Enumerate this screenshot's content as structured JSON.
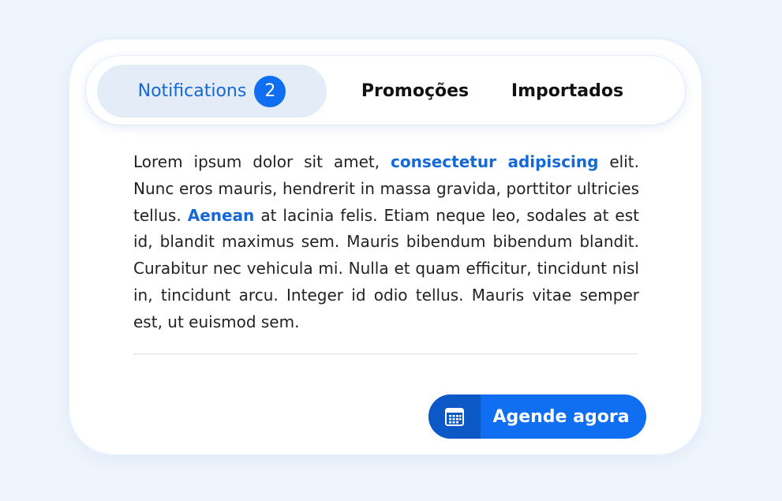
{
  "tabs": {
    "notifications": {
      "label": "Notifications",
      "badge": "2"
    },
    "promocoes": {
      "label": "Promoções"
    },
    "importados": {
      "label": "Importados"
    }
  },
  "content": {
    "p1": "Lorem ipsum dolor sit amet, ",
    "link1": "consectetur adipiscing",
    "p2": " elit. Nunc eros mauris, hendrerit in massa gravida, porttitor ultricies tellus. ",
    "link2": "Aenean",
    "p3": " at lacinia felis. Etiam neque leo, sodales at est id, blandit maximus sem. Mauris bibendum bibendum blandit. Curabitur nec vehicula mi. Nulla et quam efficitur, tincidunt nisl in, tincidunt arcu. Integer id odio tellus. Mauris vitae semper est, ut euismod sem."
  },
  "cta": {
    "label": "Agende agora",
    "icon": "calendar-icon"
  },
  "colors": {
    "accent": "#0f6ff0",
    "accent_dark": "#0b58c6",
    "active_tab_bg": "#e4ecf8",
    "page_bg": "#eff5fc"
  }
}
